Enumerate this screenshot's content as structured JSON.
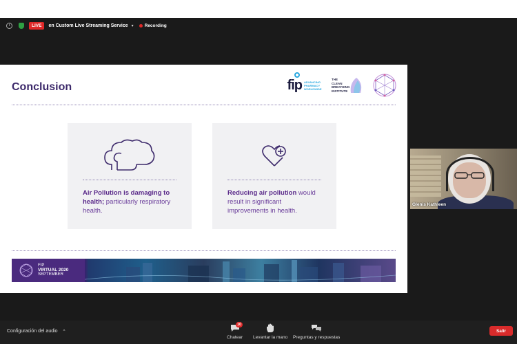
{
  "topbar": {
    "info_symbol": "i",
    "live_label": "LIVE",
    "service_label": "en Custom Live Streaming Service",
    "caret": "▾",
    "recording_label": "Recording"
  },
  "slide": {
    "title": "Conclusion",
    "logos": {
      "fip_name": "fip",
      "fip_tagline": "ADVANCING PHARMACY WORLDWIDE",
      "cbi_name": "THE CLEAN BREATHING INSTITUTE"
    },
    "cards": [
      {
        "bold": "Air Pollution is damaging to health;",
        "rest": " particularly respiratory health.",
        "icon": "cloud-icon"
      },
      {
        "bold": "Reducing air pollution",
        "rest": " would result in significant improvements in health.",
        "icon": "heart-plus-icon"
      }
    ],
    "banner": {
      "line1": "FIP",
      "line2": "VIRTUAL 2020",
      "line3": "SEPTEMBER"
    }
  },
  "participant": {
    "name": "Glenis Kathleen"
  },
  "bottombar": {
    "audio_label": "Configuración del audio",
    "audio_caret": "^",
    "chat_label": "Chatear",
    "chat_count": "10",
    "hand_label": "Levantar la mano",
    "qa_label": "Preguntas y respuestas",
    "leave_label": "Salir"
  },
  "colors": {
    "accent_purple": "#3d2a6b",
    "live_red": "#e02828",
    "leave_red": "#d92b2b"
  }
}
